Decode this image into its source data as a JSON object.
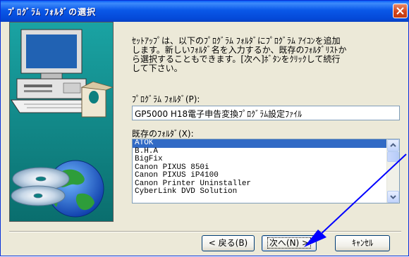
{
  "window": {
    "title": "ﾌﾟﾛｸﾞﾗﾑ ﾌｫﾙﾀﾞの選択"
  },
  "content": {
    "description": "ｾｯﾄｱｯﾌﾟは、以下のﾌﾟﾛｸﾞﾗﾑ ﾌｫﾙﾀﾞにﾌﾟﾛｸﾞﾗﾑ ｱｲｺﾝを追加\nします。新しいﾌｫﾙﾀﾞ名を入力するか、既存のﾌｫﾙﾀﾞﾘｽﾄか\nら選択することもできます。[次へ]ﾎﾞﾀﾝをｸﾘｯｸして続行\nして下さい。",
    "folder_label": "ﾌﾟﾛｸﾞﾗﾑ ﾌｫﾙﾀﾞ(P):",
    "folder_value": "GP5000 H18電子申告変換ﾌﾟﾛｸﾞﾗﾑ設定ﾌｧｲﾙ",
    "existing_label": "既存のﾌｫﾙﾀﾞ(X):",
    "existing_folders": [
      "ATOK",
      "B.H.A",
      "BigFix",
      "Canon PIXUS 850i",
      "Canon PIXUS iP4100",
      "Canon Printer Uninstaller",
      "CyberLink DVD Solution"
    ],
    "selected_folder": "ATOK"
  },
  "buttons": {
    "back": "< 戻る(B)",
    "next": "次へ(N) >",
    "cancel": "ｷｬﾝｾﾙ"
  },
  "colors": {
    "title_bar": "#0a58e8",
    "selection": "#316ac5",
    "annotation_arrow": "#0000ff"
  }
}
